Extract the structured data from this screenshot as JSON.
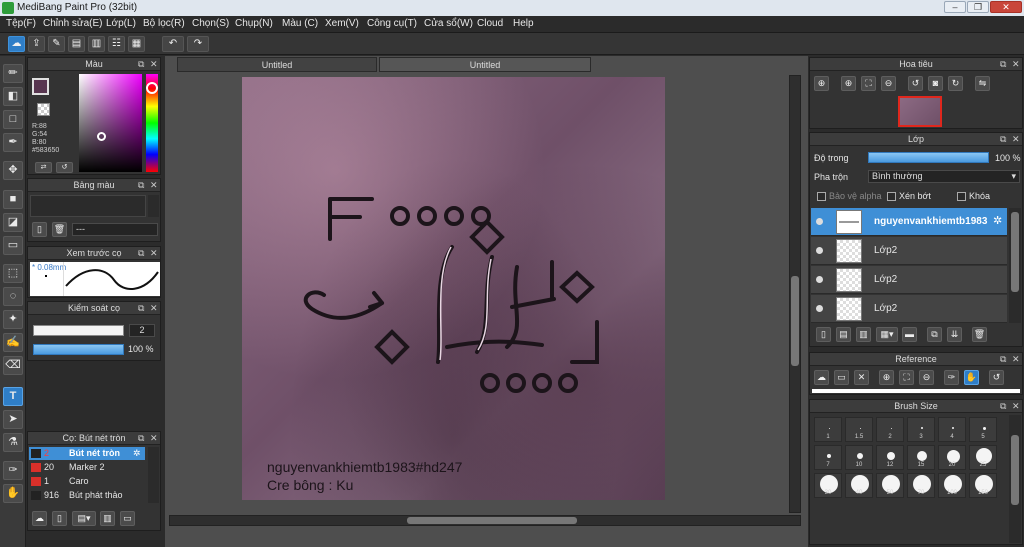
{
  "window": {
    "title": "MediBang Paint Pro (32bit)"
  },
  "menu": [
    "Tệp(F)",
    "Chỉnh sửa(E)",
    "Lớp(L)",
    "Bộ lọc(R)",
    "Chọn(S)",
    "Chụp(N)",
    "Màu (C)",
    "Xem(V)",
    "Công cụ(T)",
    "Cửa sổ(W)",
    "Cloud",
    "Help"
  ],
  "toolbar": {
    "icons": [
      "cloud-sync-icon",
      "share-icon",
      "comment-icon",
      "message-icon",
      "document-icon",
      "list-icon",
      "grid-icon"
    ],
    "undo": "undo-icon",
    "redo": "redo-icon"
  },
  "tools": [
    "brush-icon",
    "eraser-icon",
    "rectangle-icon",
    "pen-icon",
    "move-icon",
    "fill-rect-icon",
    "bucket-icon",
    "gradient-icon",
    "select-rect-icon",
    "lasso-icon",
    "magic-wand-icon",
    "select-pen-icon",
    "select-eraser-icon",
    "text-icon",
    "operation-icon",
    "dropper-icon",
    "pipette-icon",
    "hand-icon"
  ],
  "color_panel": {
    "title": "Màu",
    "foreground": "#583650",
    "r_label": "R:88",
    "g_label": "G:54",
    "b_label": "B:80",
    "hex_label": "#583650"
  },
  "palette_panel": {
    "title": "Bảng màu",
    "name": "---"
  },
  "brush_preview_panel": {
    "title": "Xem trước cọ",
    "size": "0.08mm"
  },
  "control_panel": {
    "title": "Kiểm soát cọ",
    "size_value": "2",
    "opacity_value": "100 %",
    "opacity_fraction": 1.0
  },
  "brushes_panel": {
    "title": "Cọ: Bút nét tròn",
    "items": [
      {
        "size": "2",
        "name": "Bút nét tròn",
        "color": "#222222",
        "selected": true
      },
      {
        "size": "20",
        "name": "Marker 2",
        "color": "#d9302a",
        "selected": false
      },
      {
        "size": "1",
        "name": "Caro",
        "color": "#d9302a",
        "selected": false
      },
      {
        "size": "916",
        "name": "Bút phát thảo",
        "color": "#222222",
        "selected": false
      }
    ]
  },
  "document_tabs": [
    "Untitled",
    "Untitled"
  ],
  "canvas_text": {
    "lines": [
      "nguyenvankhiemtb1983#hd247",
      "Cre bông : Ku"
    ]
  },
  "navigator_panel": {
    "title": "Hoa tiêu"
  },
  "layers_panel": {
    "title": "Lớp",
    "opacity_label": "Độ trong",
    "opacity_value": "100 %",
    "opacity_fraction": 1.0,
    "blend_label": "Pha trộn",
    "blend_value": "Bình thường",
    "protect_alpha": "Bảo vệ alpha",
    "clipping": "Xén bớt",
    "lock": "Khóa",
    "layers": [
      {
        "name": "nguyenvankhiemtb1983",
        "selected": true
      },
      {
        "name": "Lớp2",
        "selected": false
      },
      {
        "name": "Lớp2",
        "selected": false
      },
      {
        "name": "Lớp2",
        "selected": false
      }
    ]
  },
  "reference_panel": {
    "title": "Reference"
  },
  "brush_size_panel": {
    "title": "Brush Size",
    "row1": [
      "1",
      "1.5",
      "2",
      "3",
      "4",
      "5"
    ],
    "row2": [
      "7",
      "10",
      "12",
      "15",
      "20",
      "25"
    ],
    "row3": [
      "30",
      "40",
      "50",
      "70",
      "100",
      "150"
    ]
  }
}
